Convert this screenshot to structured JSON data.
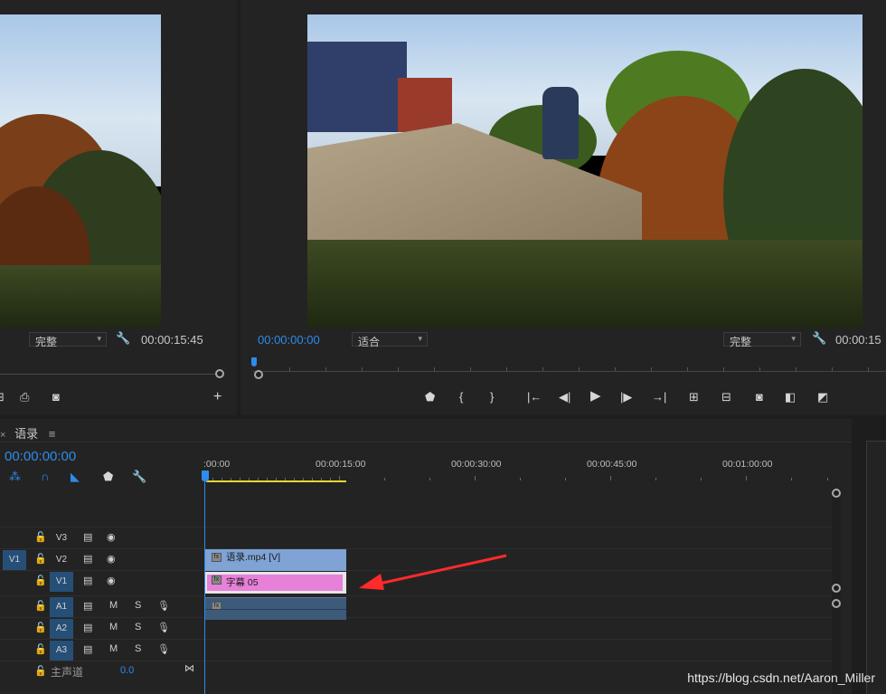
{
  "source_monitor": {
    "zoom_select": "完整",
    "timecode": "00:00:15:45"
  },
  "program_monitor": {
    "current_timecode": "00:00:00:00",
    "fit_select": "适合",
    "quality_select": "完整",
    "duration_timecode": "00:00:15"
  },
  "timeline": {
    "sequence_name": "语录",
    "current_timecode": "00:00:00:00",
    "ruler_labels": [
      ":00:00",
      "00:00:15:00",
      "00:00:30:00",
      "00:00:45:00",
      "00:01:00:00"
    ],
    "video_tracks": [
      {
        "name": "V3",
        "source_patch": ""
      },
      {
        "name": "V2",
        "source_patch": "V1"
      },
      {
        "name": "V1",
        "source_patch": ""
      }
    ],
    "audio_tracks": [
      {
        "name": "A1",
        "m": "M",
        "s": "S"
      },
      {
        "name": "A2",
        "m": "M",
        "s": "S"
      },
      {
        "name": "A3",
        "m": "M",
        "s": "S"
      }
    ],
    "master_track": {
      "label": "主声道",
      "value": "0.0"
    },
    "clips": {
      "video_clip": "语录.mp4 [V]",
      "title_clip": "字幕 05"
    },
    "colors": {
      "video_clip": "#7ea3d4",
      "title_clip": "#e680d9",
      "audio_clip": "#3e5a7a",
      "accent": "#2d8ceb",
      "arrow": "#ff2a2a"
    }
  },
  "watermark": "https://blog.csdn.net/Aaron_Miller"
}
